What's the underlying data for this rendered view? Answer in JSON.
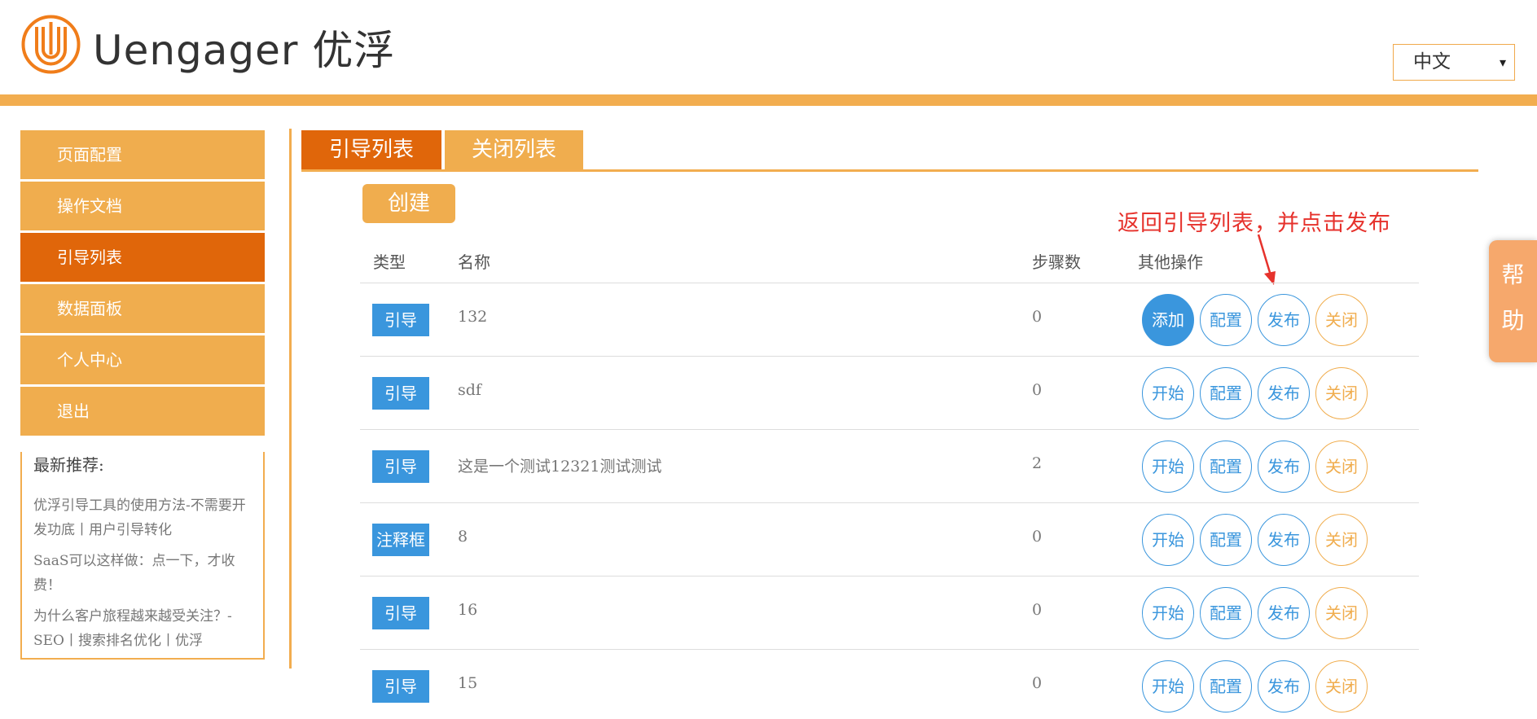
{
  "header": {
    "brand": "Uengager 优浮",
    "language": "中文",
    "language_caret": "▾"
  },
  "sidebar": {
    "items": [
      {
        "label": "页面配置",
        "active": false
      },
      {
        "label": "操作文档",
        "active": false
      },
      {
        "label": "引导列表",
        "active": true
      },
      {
        "label": "数据面板",
        "active": false
      },
      {
        "label": "个人中心",
        "active": false
      },
      {
        "label": "退出",
        "active": false
      }
    ],
    "recommend": {
      "title": "最新推荐:",
      "links": [
        "优浮引导工具的使用方法-不需要开发功底丨用户引导转化",
        "SaaS可以这样做：点一下，才收费！",
        "为什么客户旅程越来越受关注？-SEO丨搜索排名优化丨优浮"
      ]
    }
  },
  "tabs": [
    "引导列表",
    "关闭列表"
  ],
  "create_label": "创建",
  "annotation": "返回引导列表，并点击发布",
  "table": {
    "headers": {
      "type": "类型",
      "name": "名称",
      "steps": "步骤数",
      "ops": "其他操作"
    },
    "rows": [
      {
        "type": "引导",
        "name": "132",
        "steps": "0",
        "op1": "添加",
        "op2": "配置",
        "op3": "发布",
        "op4": "关闭"
      },
      {
        "type": "引导",
        "name": "sdf",
        "steps": "0",
        "op1": "开始",
        "op2": "配置",
        "op3": "发布",
        "op4": "关闭"
      },
      {
        "type": "引导",
        "name": "这是一个测试12321测试测试",
        "steps": "2",
        "op1": "开始",
        "op2": "配置",
        "op3": "发布",
        "op4": "关闭"
      },
      {
        "type": "注释框",
        "name": "8",
        "steps": "0",
        "op1": "开始",
        "op2": "配置",
        "op3": "发布",
        "op4": "关闭"
      },
      {
        "type": "引导",
        "name": "16",
        "steps": "0",
        "op1": "开始",
        "op2": "配置",
        "op3": "发布",
        "op4": "关闭"
      },
      {
        "type": "引导",
        "name": "15",
        "steps": "0",
        "op1": "开始",
        "op2": "配置",
        "op3": "发布",
        "op4": "关闭"
      }
    ]
  },
  "help": {
    "char1": "帮",
    "char2": "助"
  },
  "colors": {
    "accent": "#f0ad4e",
    "active": "#e0660a",
    "blue": "#3a96dd",
    "annotation": "#e6322c"
  }
}
